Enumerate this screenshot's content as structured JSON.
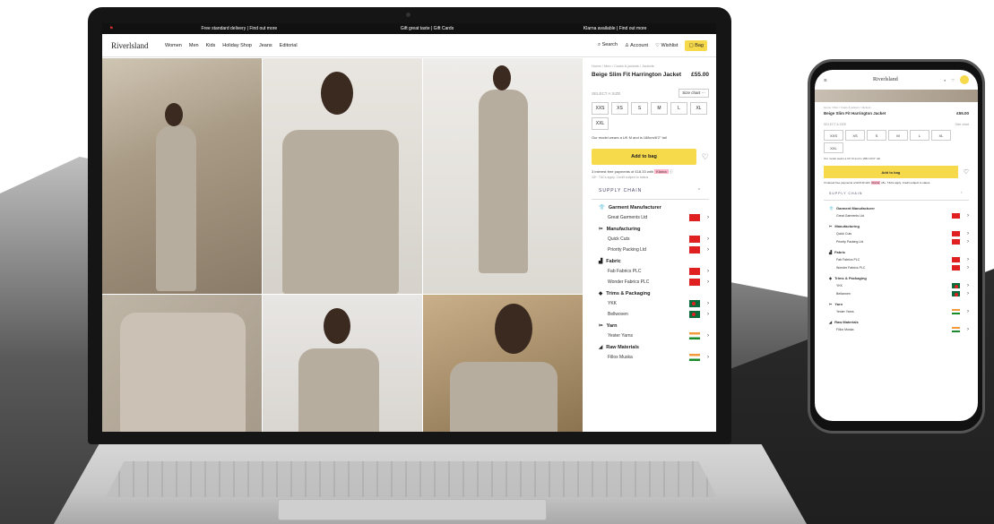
{
  "banner": {
    "left_icon": "uk-flag-icon",
    "items": [
      "Free standard delivery | Find out more",
      "Gift great taste | Gift Cards",
      "Klarna available | Find out more"
    ]
  },
  "header": {
    "logo": "Riverlsland",
    "nav": [
      "Women",
      "Men",
      "Kids",
      "Holiday Shop",
      "Jeans",
      "Editorial"
    ],
    "search": "Search",
    "account": "Account",
    "wishlist": "Wishlist",
    "bag": "Bag"
  },
  "product": {
    "breadcrumb": "Home / Men / Coats & jackets / Jackets",
    "title": "Beige Slim Fit Harrington Jacket",
    "price": "£55.00",
    "select_size": "SELECT A SIZE",
    "size_chart": "Size chart",
    "sizes": [
      "XXS",
      "XS",
      "S",
      "M",
      "L",
      "XL",
      "XXL"
    ],
    "model_note": "Our model wears a UK M and is 188cm/6'2\" tall",
    "add_to_bag": "Add to bag",
    "klarna": "3 interest free payments of £18.33 with",
    "klarna_brand": "Klarna",
    "klarna_note": "18+. T&Cs apply. Credit subject to status."
  },
  "supply_chain": {
    "heading": "SUPPLY CHAIN",
    "categories": [
      {
        "name": "Garment Manufacturer",
        "suppliers": [
          {
            "name": "Great Garments Ltd",
            "flag": "cn"
          }
        ]
      },
      {
        "name": "Manufacturing",
        "suppliers": [
          {
            "name": "Quick Cuts",
            "flag": "cn"
          },
          {
            "name": "Priority Packing Ltd",
            "flag": "cn"
          }
        ]
      },
      {
        "name": "Fabric",
        "suppliers": [
          {
            "name": "Fab Fabrics PLC",
            "flag": "cn"
          },
          {
            "name": "Wonder Fabrics PLC",
            "flag": "cn"
          }
        ]
      },
      {
        "name": "Trims & Packaging",
        "suppliers": [
          {
            "name": "YKK",
            "flag": "bd"
          },
          {
            "name": "Bellwoven",
            "flag": "bd"
          }
        ]
      },
      {
        "name": "Yarn",
        "suppliers": [
          {
            "name": "Yester Yarns",
            "flag": "in"
          }
        ]
      },
      {
        "name": "Raw Materials",
        "suppliers": [
          {
            "name": "Fillox Muska",
            "flag": "in"
          }
        ]
      }
    ]
  },
  "colors": {
    "accent": "#f7d94c",
    "banner": "#111111"
  }
}
